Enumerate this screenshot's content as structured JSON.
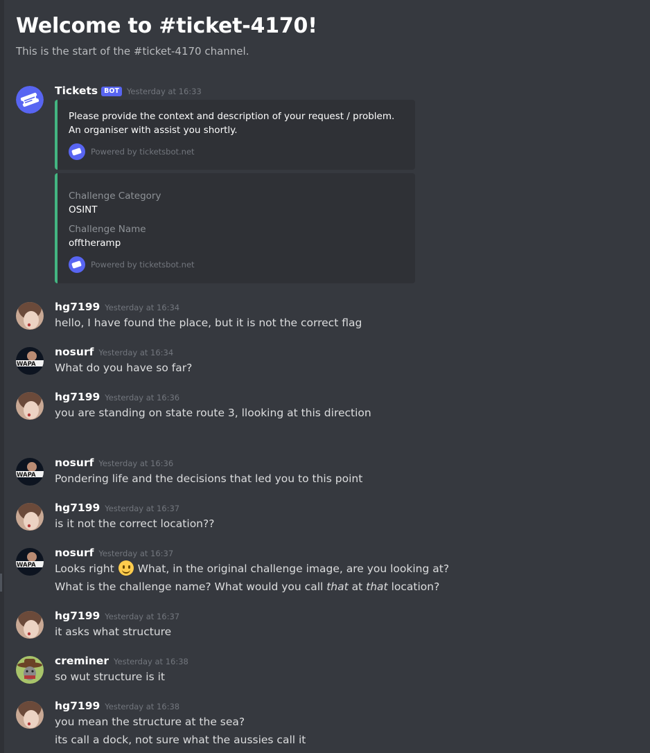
{
  "channel": {
    "title": "Welcome to #ticket-4170!",
    "subtitle": "This is the start of the #ticket-4170 channel."
  },
  "messages": [
    {
      "author": "Tickets",
      "bot_tag": "BOT",
      "timestamp": "Yesterday at 16:33"
    },
    {
      "author": "hg7199",
      "timestamp": "Yesterday at 16:34",
      "lines": [
        "hello, I have found the place, but it is not the correct flag"
      ]
    },
    {
      "author": "nosurf",
      "timestamp": "Yesterday at 16:34",
      "lines": [
        "What do you have so far?"
      ]
    },
    {
      "author": "hg7199",
      "timestamp": "Yesterday at 16:36",
      "lines": [
        "you are standing on state route 3, llooking at this direction"
      ]
    },
    {
      "author": "nosurf",
      "timestamp": "Yesterday at 16:36",
      "lines": [
        "Pondering life and the decisions that led you to this point"
      ]
    },
    {
      "author": "hg7199",
      "timestamp": "Yesterday at 16:37",
      "lines": [
        "is it not the correct location??"
      ]
    },
    {
      "author": "nosurf",
      "timestamp": "Yesterday at 16:37",
      "line1_pre": "Looks right",
      "line1_emoji": "slightly-smiling-face",
      "line1_post": "What, in the original challenge image, are you looking at?",
      "line2_a": "What is the challenge name? What would you call ",
      "line2_b": "that",
      "line2_c": " at ",
      "line2_d": "that",
      "line2_e": " location?"
    },
    {
      "author": "hg7199",
      "timestamp": "Yesterday at 16:37",
      "lines": [
        "it asks what structure"
      ]
    },
    {
      "author": "creminer",
      "timestamp": "Yesterday at 16:38",
      "lines": [
        "so wut structure is it"
      ]
    },
    {
      "author": "hg7199",
      "timestamp": "Yesterday at 16:38",
      "lines": [
        "you mean the structure at the sea?",
        "its call a dock, not sure what the aussies call it"
      ]
    }
  ],
  "embeds": [
    {
      "description": "Please provide the context and description of your request / problem. An organiser with assist you shortly.",
      "footer": "Powered by ticketsbot.net"
    },
    {
      "fields": [
        {
          "name": "Challenge Category",
          "value": "OSINT"
        },
        {
          "name": "Challenge Name",
          "value": "offtheramp"
        }
      ],
      "footer": "Powered by ticketsbot.net"
    }
  ],
  "colors": {
    "background": "#36393f",
    "embed_bg": "#2f3136",
    "embed_accent": "#43b581",
    "bot_tag": "#5865f2",
    "timestamp": "#72767d"
  }
}
